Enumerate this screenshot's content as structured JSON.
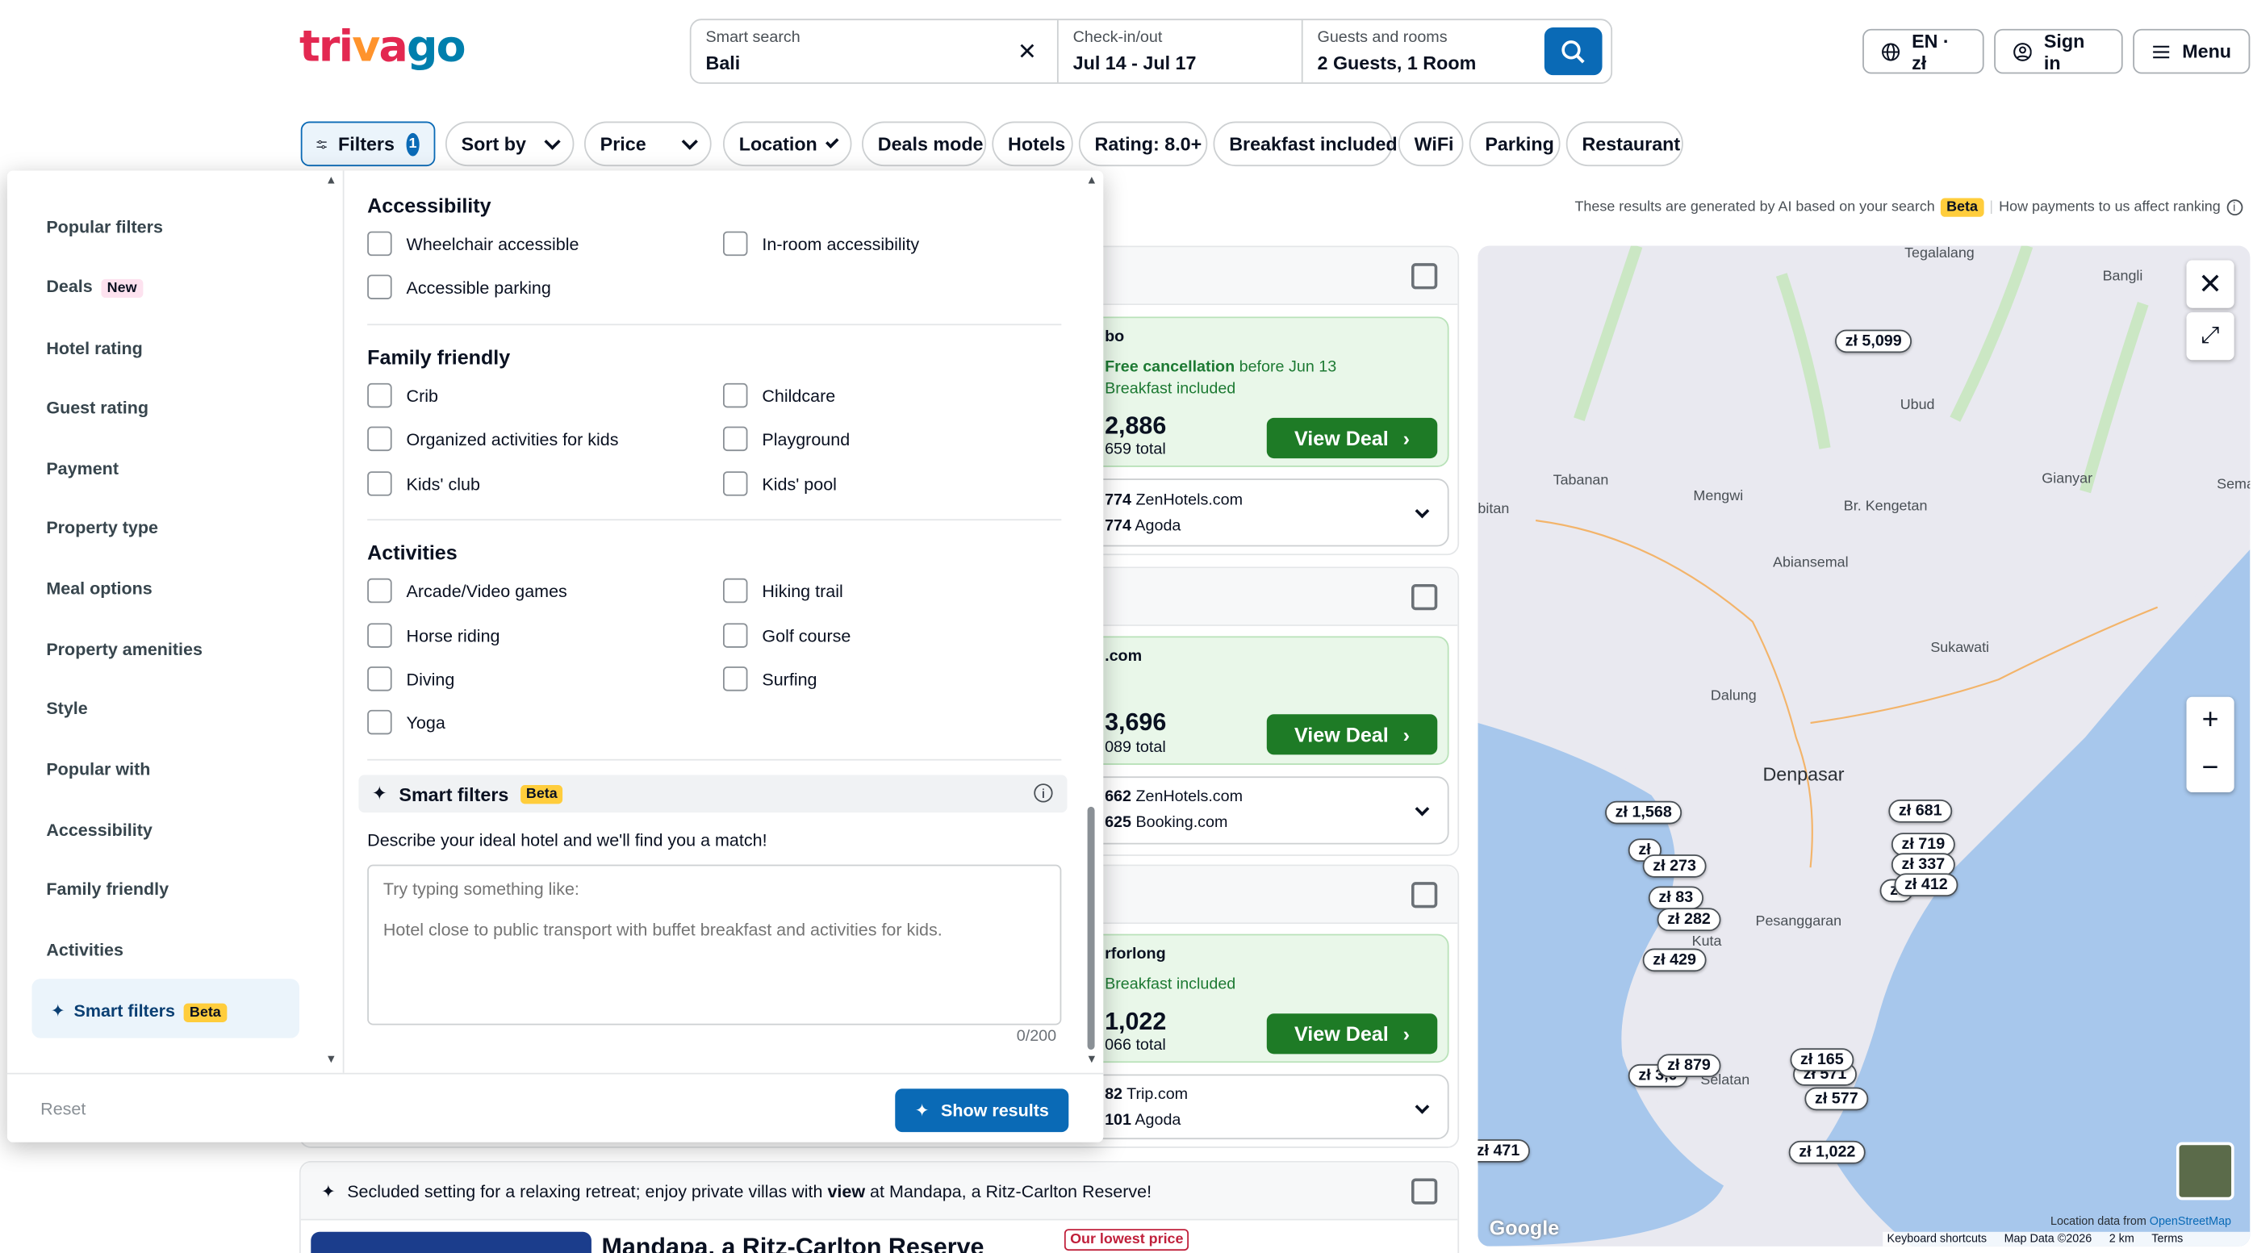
{
  "header": {
    "logo": {
      "part1": "tri",
      "part2": "v",
      "part3": "a",
      "part4": "go"
    },
    "search": {
      "label": "Smart search",
      "value": "Bali"
    },
    "checkin": {
      "label": "Check-in/out",
      "value": "Jul 14 - Jul 17"
    },
    "guests": {
      "label": "Guests and rooms",
      "value": "2 Guests, 1 Room"
    },
    "lang": "EN · zł",
    "signin": "Sign in",
    "menu": "Menu"
  },
  "chips": {
    "filters": "Filters",
    "filters_count": "1",
    "sort": "Sort by",
    "price": "Price",
    "location": "Location",
    "deals": "Deals mode",
    "hotels": "Hotels",
    "rating": "Rating: 8.0+",
    "breakfast": "Breakfast included",
    "wifi": "WiFi",
    "parking": "Parking",
    "restaurant": "Restaurant"
  },
  "disclaimer": {
    "text": "These results are generated by AI based on your search",
    "beta": "Beta",
    "ranking": "How payments to us affect ranking"
  },
  "results": [
    {
      "provider": "bo",
      "free": "Free cancellation",
      "free_until": "before Jun 13",
      "breakfast": "Breakfast included",
      "price": "2,886",
      "total": "659 total",
      "cta": "View Deal",
      "alt1_price": "774",
      "alt1_site": "ZenHotels.com",
      "alt2_price": "774",
      "alt2_site": "Agoda"
    },
    {
      "provider": ".com",
      "price": "3,696",
      "total": "089 total",
      "cta": "View Deal",
      "alt1_price": "662",
      "alt1_site": "ZenHotels.com",
      "alt2_price": "625",
      "alt2_site": "Booking.com"
    },
    {
      "provider": "rforlong",
      "breakfast": "Breakfast included",
      "price": "1,022",
      "total": "066 total",
      "cta": "View Deal",
      "alt1_price": "82",
      "alt1_site": "Trip.com",
      "alt2_price": "101",
      "alt2_site": "Agoda"
    }
  ],
  "bottom_card": {
    "tagline_pre": "Secluded setting for a relaxing retreat; enjoy private villas with ",
    "tagline_bold": "view",
    "tagline_post": " at Mandapa, a Ritz-Carlton Reserve!",
    "hotel": "Mandapa, a Ritz-Carlton Reserve",
    "lowest": "Our lowest price"
  },
  "map": {
    "places": [
      "Tegalalang",
      "Bangli",
      "Ubud",
      "Tabanan",
      "Mengwi",
      "Gianyar",
      "Br. Kengetan",
      "Abiansemal",
      "Sema",
      "bitan",
      "Sukawati",
      "Dalung",
      "Denpasar",
      "Pesanggaran",
      "Kuta",
      "Selatan"
    ],
    "pins": [
      "zł 5,099",
      "zł 1,568",
      "zł 273",
      "zł 83",
      "zł 282",
      "zł 429",
      "zł 681",
      "zł 719",
      "zł 337",
      "zł 412",
      "zł 879",
      "zł 3,0",
      "zł 165",
      "zł 577",
      "zł 1,022",
      "zł 471",
      "zł",
      "zł",
      "zł 571"
    ],
    "footer": {
      "location": "Location data from",
      "osm": "OpenStreetMap",
      "shortcuts": "Keyboard shortcuts",
      "mapdata": "Map Data ©2026",
      "scale": "2 km",
      "terms": "Terms"
    },
    "google": "Google"
  },
  "panel": {
    "nav": [
      "Popular filters",
      "Deals",
      "Hotel rating",
      "Guest rating",
      "Payment",
      "Property type",
      "Meal options",
      "Property amenities",
      "Style",
      "Popular with",
      "Accessibility",
      "Family friendly",
      "Activities"
    ],
    "nav_new": "New",
    "nav_smart": "Smart filters",
    "nav_smart_badge": "Beta",
    "accessibility": {
      "title": "Accessibility",
      "items": [
        "Wheelchair accessible",
        "In-room accessibility",
        "Accessible parking"
      ]
    },
    "family": {
      "title": "Family friendly",
      "items": [
        "Crib",
        "Childcare",
        "Organized activities for kids",
        "Playground",
        "Kids' club",
        "Kids' pool"
      ]
    },
    "activities": {
      "title": "Activities",
      "items": [
        "Arcade/Video games",
        "Hiking trail",
        "Horse riding",
        "Golf course",
        "Diving",
        "Surfing",
        "Yoga"
      ]
    },
    "smart": {
      "title": "Smart filters",
      "badge": "Beta",
      "desc": "Describe your ideal hotel and we'll find you a match!",
      "placeholder": "Try typing something like:\n\nHotel close to public transport with buffet breakfast and activities for kids.",
      "counter": "0/200"
    },
    "reset": "Reset",
    "show": "Show results"
  }
}
